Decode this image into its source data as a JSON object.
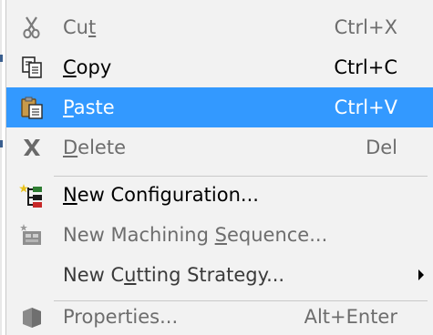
{
  "menu": {
    "items": [
      {
        "pre": "Cu",
        "ul": "t",
        "post": "",
        "shortcut": "Ctrl+X",
        "state": "disabled",
        "icon": "scissors-icon"
      },
      {
        "pre": "",
        "ul": "C",
        "post": "opy",
        "shortcut": "Ctrl+C",
        "state": "enabled",
        "icon": "copy-icon"
      },
      {
        "pre": "",
        "ul": "P",
        "post": "aste",
        "shortcut": "Ctrl+V",
        "state": "highlighted",
        "icon": "paste-icon"
      },
      {
        "pre": "",
        "ul": "D",
        "post": "elete",
        "shortcut": "Del",
        "state": "disabled",
        "icon": "delete-x-icon"
      },
      {
        "pre": "",
        "ul": "N",
        "post": "ew Configuration...",
        "shortcut": "",
        "state": "enabled",
        "icon": "new-configuration-icon"
      },
      {
        "pre": "New Machining ",
        "ul": "S",
        "post": "equence...",
        "shortcut": "",
        "state": "disabled",
        "icon": "new-machining-sequence-icon"
      },
      {
        "pre": "New C",
        "ul": "u",
        "post": "tting Strategy...",
        "shortcut": "",
        "state": "enabled",
        "icon": "",
        "submenu": true
      },
      {
        "pre": "Properties...",
        "ul": "",
        "post": "",
        "shortcut": "Alt+Enter",
        "state": "disabled",
        "icon": "properties-icon"
      }
    ]
  },
  "colors": {
    "highlight": "#3399ff",
    "menu_background": "#f2f2f2",
    "disabled_text": "#6d6d6d"
  }
}
